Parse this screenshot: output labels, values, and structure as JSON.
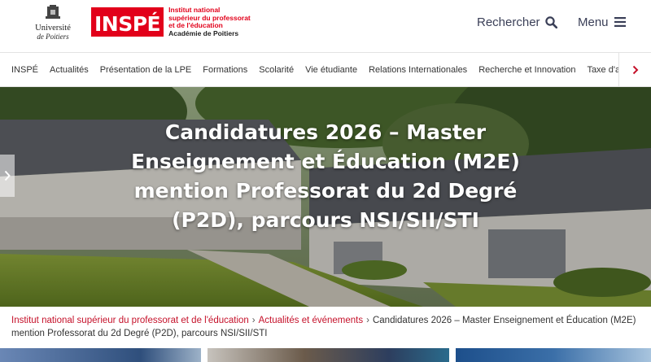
{
  "header": {
    "university_logo": {
      "line1": "Université",
      "line2": "de Poitiers"
    },
    "inspe_logo": {
      "mark": "INSPÉ",
      "line1": "Institut national",
      "line2": "supérieur du professorat",
      "line3": "et de l'éducation",
      "line4": "Académie de Poitiers"
    },
    "search_label": "Rechercher",
    "menu_label": "Menu",
    "icons": {
      "search": "search-icon",
      "menu": "hamburger-icon"
    }
  },
  "nav": {
    "items": [
      {
        "label": "INSPÉ"
      },
      {
        "label": "Actualités"
      },
      {
        "label": "Présentation de la LPE"
      },
      {
        "label": "Formations"
      },
      {
        "label": "Scolarité"
      },
      {
        "label": "Vie étudiante"
      },
      {
        "label": "Relations Internationales"
      },
      {
        "label": "Recherche et Innovation"
      },
      {
        "label": "Taxe d'appr"
      }
    ],
    "next_icon": "chevron-right-icon"
  },
  "hero": {
    "title": "Candidatures 2026 – Master Enseignement et Éducation (M2E) mention Professorat du 2d Degré (P2D), parcours NSI/SII/STI",
    "prev_icon": "chevron-left-icon"
  },
  "breadcrumb": {
    "items": [
      {
        "label": "Institut national supérieur du professorat et de l'éducation"
      },
      {
        "label": "Actualités et événements"
      },
      {
        "label": "Candidatures 2026 – Master Enseignement et Éducation (M2E) mention Professorat du 2d Degré (P2D), parcours NSI/SII/STI"
      }
    ],
    "separator": "›"
  },
  "colors": {
    "brand_red": "#e2001a",
    "link_red": "#c5112a",
    "nav_text": "#333333",
    "header_text": "#3a3f57"
  }
}
